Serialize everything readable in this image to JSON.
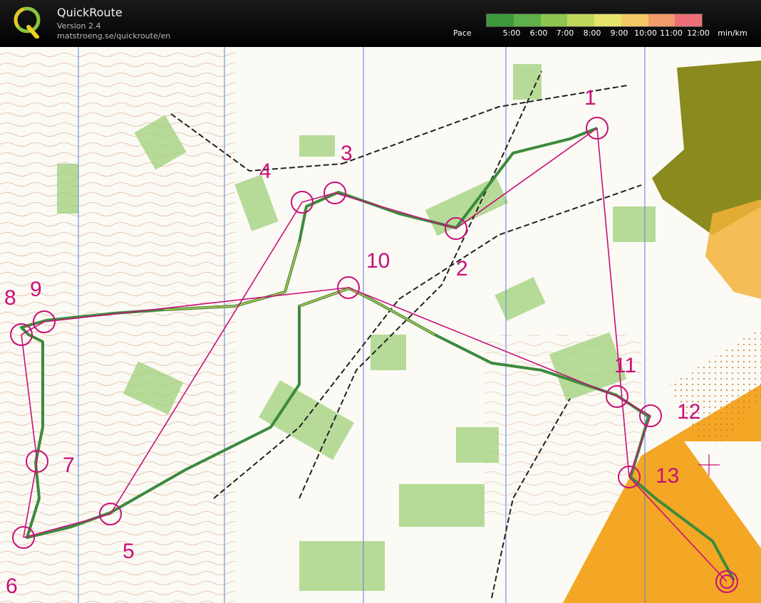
{
  "app": {
    "name": "QuickRoute",
    "version": "Version 2.4",
    "url": "matstroeng.se/quickroute/en"
  },
  "pace_legend": {
    "label": "Pace",
    "unit": "min/km",
    "ticks": [
      "5:00",
      "6:00",
      "7:00",
      "8:00",
      "9:00",
      "10:00",
      "11:00",
      "12:00"
    ],
    "colors": [
      "#3c9a3c",
      "#5fb04a",
      "#8cc64e",
      "#bfd85a",
      "#e7e46a",
      "#f2c964",
      "#f19a6a",
      "#ee6f78"
    ]
  },
  "course": {
    "color": "#c8107a",
    "controls": [
      {
        "label": "1"
      },
      {
        "label": "2"
      },
      {
        "label": "3"
      },
      {
        "label": "4"
      },
      {
        "label": "5"
      },
      {
        "label": "6"
      },
      {
        "label": "7"
      },
      {
        "label": "8"
      },
      {
        "label": "9"
      },
      {
        "label": "10"
      },
      {
        "label": "11"
      },
      {
        "label": "12"
      },
      {
        "label": "13"
      }
    ]
  }
}
